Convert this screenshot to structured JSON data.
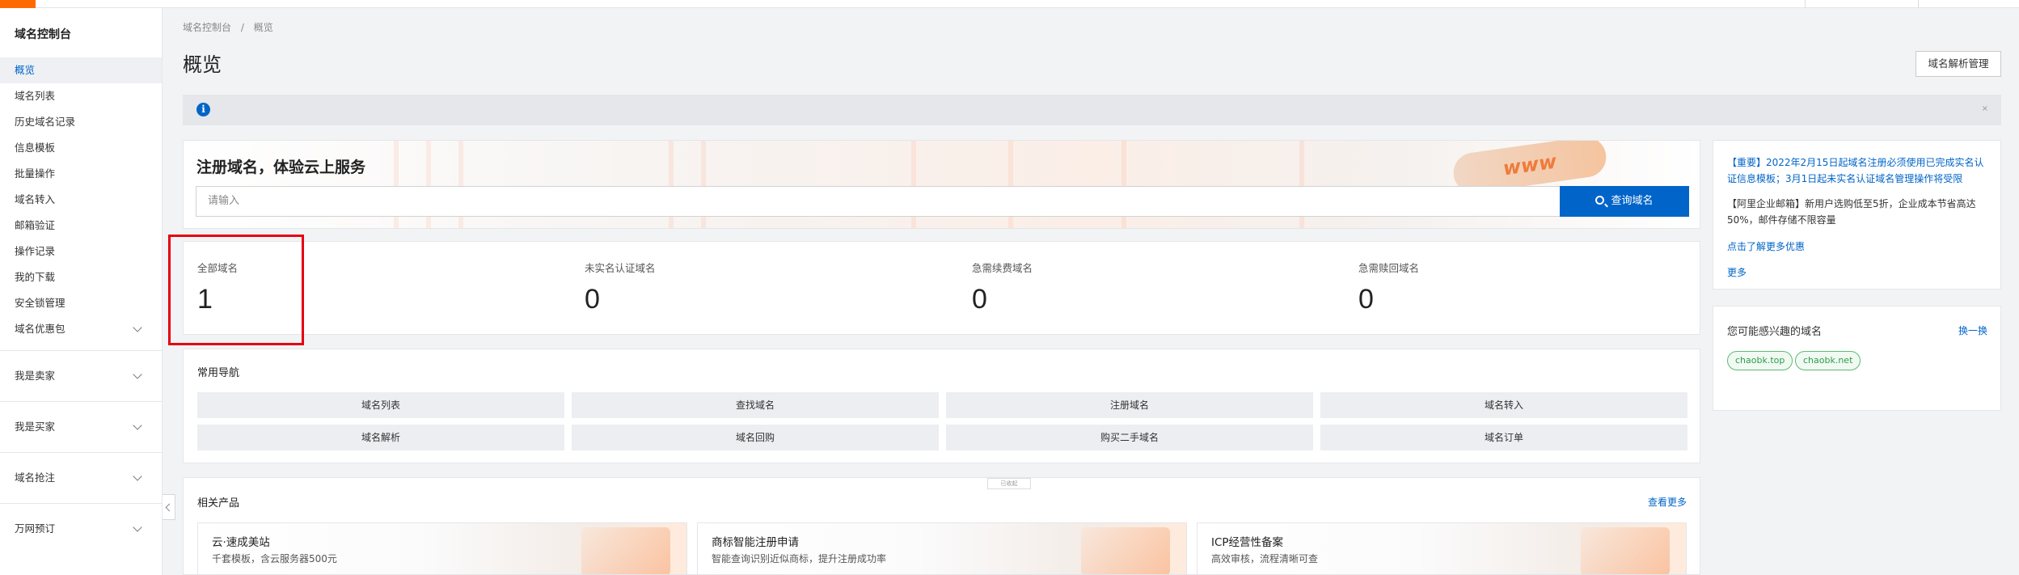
{
  "sidebar": {
    "title": "域名控制台",
    "items": [
      {
        "label": "概览",
        "active": true
      },
      {
        "label": "域名列表"
      },
      {
        "label": "历史域名记录"
      },
      {
        "label": "信息模板"
      },
      {
        "label": "批量操作"
      },
      {
        "label": "域名转入"
      },
      {
        "label": "邮箱验证"
      },
      {
        "label": "操作记录"
      },
      {
        "label": "我的下载"
      },
      {
        "label": "安全锁管理"
      },
      {
        "label": "域名优惠包"
      }
    ],
    "groups": [
      {
        "label": "我是卖家"
      },
      {
        "label": "我是买家"
      },
      {
        "label": "域名抢注"
      },
      {
        "label": "万网预订"
      }
    ]
  },
  "breadcrumb": {
    "root": "域名控制台",
    "separator": "/",
    "current": "概览"
  },
  "page": {
    "title": "概览",
    "dns_button": "域名解析管理"
  },
  "info_bar": {
    "icon": "info-icon",
    "close": "×"
  },
  "register": {
    "title": "注册域名，体验云上服务",
    "placeholder": "请输入",
    "search_button": "查询域名",
    "decor_text": "www"
  },
  "stats": [
    {
      "label": "全部域名",
      "value": "1"
    },
    {
      "label": "未实名认证域名",
      "value": "0"
    },
    {
      "label": "急需续费域名",
      "value": "0"
    },
    {
      "label": "急需赎回域名",
      "value": "0"
    }
  ],
  "nav": {
    "title": "常用导航",
    "links": [
      "域名列表",
      "查找域名",
      "注册域名",
      "域名转入",
      "域名解析",
      "域名回购",
      "购买二手域名",
      "域名订单"
    ]
  },
  "products": {
    "title": "相关产品",
    "more": "查看更多",
    "badge": "已收起",
    "items": [
      {
        "title": "云·速成美站",
        "desc": "千套模板，含云服务器500元"
      },
      {
        "title": "商标智能注册申请",
        "desc": "智能查询识别近似商标，提升注册成功率"
      },
      {
        "title": "ICP经营性备案",
        "desc": "高效审核，流程清晰可查"
      }
    ]
  },
  "notice": {
    "n1": "【重要】2022年2月15日起域名注册必须使用已完成实名认证信息模板；3月1日起未实名认证域名管理操作将受限",
    "n2": "【阿里企业邮箱】新用户选购低至5折，企业成本节省高达50%，邮件存储不限容量",
    "link1": "点击了解更多优惠",
    "link2": "更多"
  },
  "interest": {
    "title": "您可能感兴趣的域名",
    "swap": "换一换",
    "chips": [
      "chaobk.top",
      "chaobk.net"
    ]
  }
}
